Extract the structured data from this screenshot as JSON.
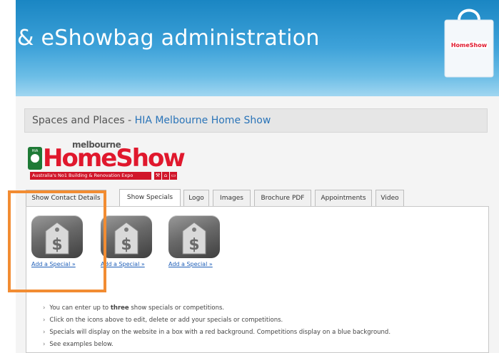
{
  "header": {
    "title": "& eShowbag administration",
    "bag_logo_text": "HomeShow"
  },
  "location": {
    "prefix": "Spaces and Places - ",
    "show_name": "HIA Melbourne Home Show"
  },
  "logo": {
    "small_word": "melbourne",
    "big_word": "HomeShow",
    "badge_text": "HIA",
    "tagline": "Australia's No1 Building & Renovation Expo"
  },
  "tabs": [
    {
      "label": "Show Contact Details"
    },
    {
      "label": "Show Specials",
      "active": true
    },
    {
      "label": "Logo"
    },
    {
      "label": "Images"
    },
    {
      "label": "Brochure PDF"
    },
    {
      "label": "Appointments"
    },
    {
      "label": "Video"
    }
  ],
  "specials": [
    {
      "link": "Add a Special »"
    },
    {
      "link": "Add a Special »"
    },
    {
      "link": "Add a Special »"
    }
  ],
  "notes": {
    "n1_pre": "You can enter up to ",
    "n1_bold": "three",
    "n1_post": " show specials or competitions.",
    "n2": "Click on the icons above to edit, delete or add your specials or competitions.",
    "n3": "Specials will display on the website in a box with a red background. Competitions display on a blue background.",
    "n4": "See examples below."
  },
  "colors": {
    "header_blue": "#1a86c3",
    "highlight_orange": "#f28c32",
    "link_blue": "#2a74b8",
    "brand_red": "#e0182d",
    "brand_green": "#1e7a36"
  },
  "icons": [
    "price-tag-dollar-icon",
    "shopping-bag-icon",
    "chevron-right-icon"
  ]
}
